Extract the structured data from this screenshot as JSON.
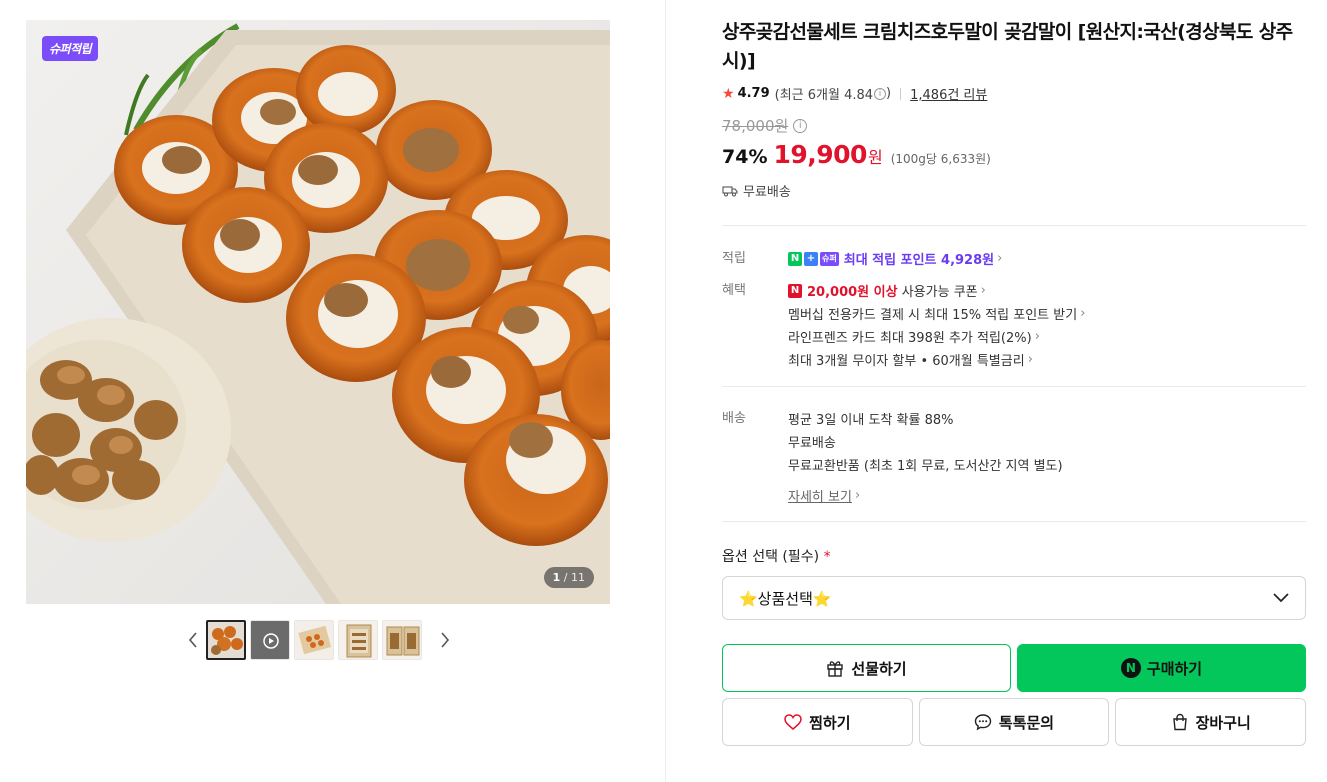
{
  "gallery": {
    "badge": "슈퍼적립",
    "counter_current": "1",
    "counter_total": "11",
    "thumbnail_count": 5,
    "active_thumbnail": 1
  },
  "product": {
    "title": "상주곶감선물세트 크림치즈호두말이 곶감말이 [원산지:국산(경상북도 상주시)]",
    "rating": "4.79",
    "recent_rating": "(최근 6개월 4.84",
    "recent_rating_close": ")",
    "review_count": "1,486건 리뷰",
    "original_price": "78,000원",
    "discount": "74%",
    "price": "19,900",
    "price_unit": "원",
    "unit_price": "(100g당 6,633원)",
    "shipping_badge": "무료배송"
  },
  "points": {
    "label": "적립",
    "badge_super": "슈퍼",
    "text": "최대 적립 포인트 4,928원"
  },
  "benefits": {
    "label": "혜택",
    "coupon_amount": "20,000원 이상",
    "coupon_text": "사용가능 쿠폰",
    "items": [
      "멤버십 전용카드 결제 시 최대 15% 적립 포인트 받기",
      "라인프렌즈 카드 최대 398원 추가 적립(2%)",
      "최대 3개월 무이자 할부 • 60개월 특별금리"
    ]
  },
  "delivery": {
    "label": "배송",
    "items": [
      "평균 3일 이내 도착 확률 88%",
      "무료배송",
      "무료교환반품 (최초 1회 무료, 도서산간 지역 별도)"
    ],
    "detail_link": "자세히 보기"
  },
  "options": {
    "label": "옵션 선택 (필수)",
    "required_mark": "*",
    "selected": "⭐상품선택⭐"
  },
  "actions": {
    "gift": "선물하기",
    "buy": "구매하기",
    "wish": "찜하기",
    "talk": "톡톡문의",
    "cart": "장바구니"
  },
  "colors": {
    "accent_green": "#03c75a",
    "price_red": "#e1122b",
    "super_purple": "#7b4dfa"
  }
}
